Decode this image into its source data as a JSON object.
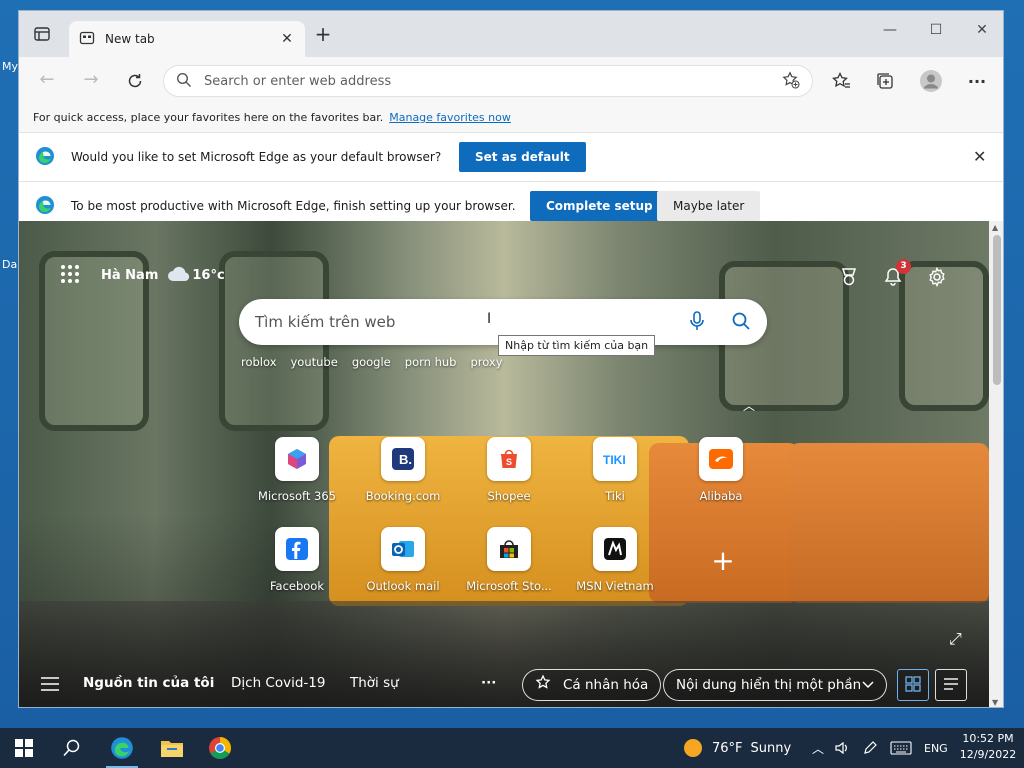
{
  "desktop": {
    "labels": [
      "My",
      "Da"
    ]
  },
  "tab": {
    "title": "New tab"
  },
  "address": {
    "placeholder": "Search or enter web address"
  },
  "favbar": {
    "message": "For quick access, place your favorites here on the favorites bar.",
    "link": "Manage favorites now"
  },
  "infobar_default": {
    "message": "Would you like to set Microsoft Edge as your default browser?",
    "button": "Set as default"
  },
  "infobar_setup": {
    "message": "To be most productive with Microsoft Edge, finish setting up your browser.",
    "primary": "Complete setup",
    "secondary": "Maybe later"
  },
  "ntp": {
    "location": "Hà Nam",
    "temperature": "16°c",
    "notifications": "3",
    "search_placeholder": "Tìm kiếm trên web",
    "tooltip": "Nhập từ tìm kiếm của bạn",
    "trending": [
      "roblox",
      "youtube",
      "google",
      "porn hub",
      "proxy"
    ],
    "tiles": [
      {
        "label": "Microsoft 365",
        "icon": "microsoft-365-icon"
      },
      {
        "label": "Booking.com",
        "icon": "booking-icon"
      },
      {
        "label": "Shopee",
        "icon": "shopee-icon"
      },
      {
        "label": "Tiki",
        "icon": "tiki-icon"
      },
      {
        "label": "Alibaba",
        "icon": "alibaba-icon"
      },
      {
        "label": "Facebook",
        "icon": "facebook-icon"
      },
      {
        "label": "Outlook mail",
        "icon": "outlook-icon"
      },
      {
        "label": "Microsoft Sto...",
        "icon": "microsoft-store-icon"
      },
      {
        "label": "MSN Vietnam",
        "icon": "msn-icon"
      }
    ],
    "bottom": {
      "feed": "Nguồn tin của tôi",
      "covid": "Dịch Covid-19",
      "news": "Thời sự",
      "more": "···",
      "personalize": "Cá nhân hóa",
      "content": "Nội dung hiển thị một phần"
    }
  },
  "taskbar": {
    "weather_temp": "76°F",
    "weather_text": "Sunny",
    "lang": "ENG",
    "time": "10:52 PM",
    "date": "12/9/2022"
  },
  "colors": {
    "accent": "#0f6cbd",
    "badge": "#d13438",
    "taskbar": "#1a2a3f"
  }
}
